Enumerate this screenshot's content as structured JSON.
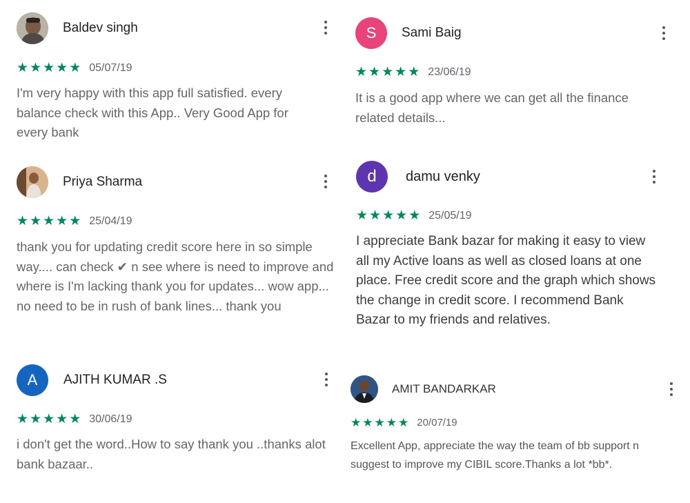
{
  "colors": {
    "star": "#01875f",
    "avatar_sami": "#e8437a",
    "avatar_damu": "#5e35b1",
    "avatar_ajith": "#1565c0"
  },
  "reviews": [
    {
      "name": "Baldev singh",
      "avatar_type": "photo",
      "avatar_icon": "user-photo",
      "stars": 5,
      "date": "05/07/19",
      "text": "I'm very happy with this app full satisfied. every balance check with this App.. Very Good App for every bank"
    },
    {
      "name": "Priya Sharma",
      "avatar_type": "photo",
      "avatar_icon": "user-photo",
      "stars": 5,
      "date": "25/04/19",
      "text": "thank you for updating credit score here in so simple way.... can check ✔ n see where is need to improve and where is I'm lacking thank you for updates... wow app... no need to be in rush of bank lines... thank you"
    },
    {
      "name": "AJITH KUMAR .S",
      "avatar_letter": "A",
      "stars": 5,
      "date": "30/06/19",
      "text": "i don't get the word..How to say thank you ..thanks alot bank bazaar.."
    },
    {
      "name": "Sami Baig",
      "avatar_letter": "S",
      "stars": 5,
      "date": "23/06/19",
      "text": "It is a good app where we can get all the finance related details..."
    },
    {
      "name": "damu venky",
      "avatar_letter": "d",
      "stars": 5,
      "date": "25/05/19",
      "text": "I appreciate Bank bazar for making it easy to view all my Active loans as well as closed loans at one place. Free credit score and the graph which shows the change in credit score. I recommend Bank Bazar to my friends and relatives."
    },
    {
      "name": "AMIT BANDARKAR",
      "avatar_type": "photo",
      "avatar_icon": "user-photo",
      "stars": 5,
      "date": "20/07/19",
      "text": "Excellent App, appreciate the way the team of bb support n suggest to improve my CIBIL score.Thanks a lot *bb*."
    }
  ],
  "menu_icon": "more-vert-icon",
  "star_glyph": "★"
}
